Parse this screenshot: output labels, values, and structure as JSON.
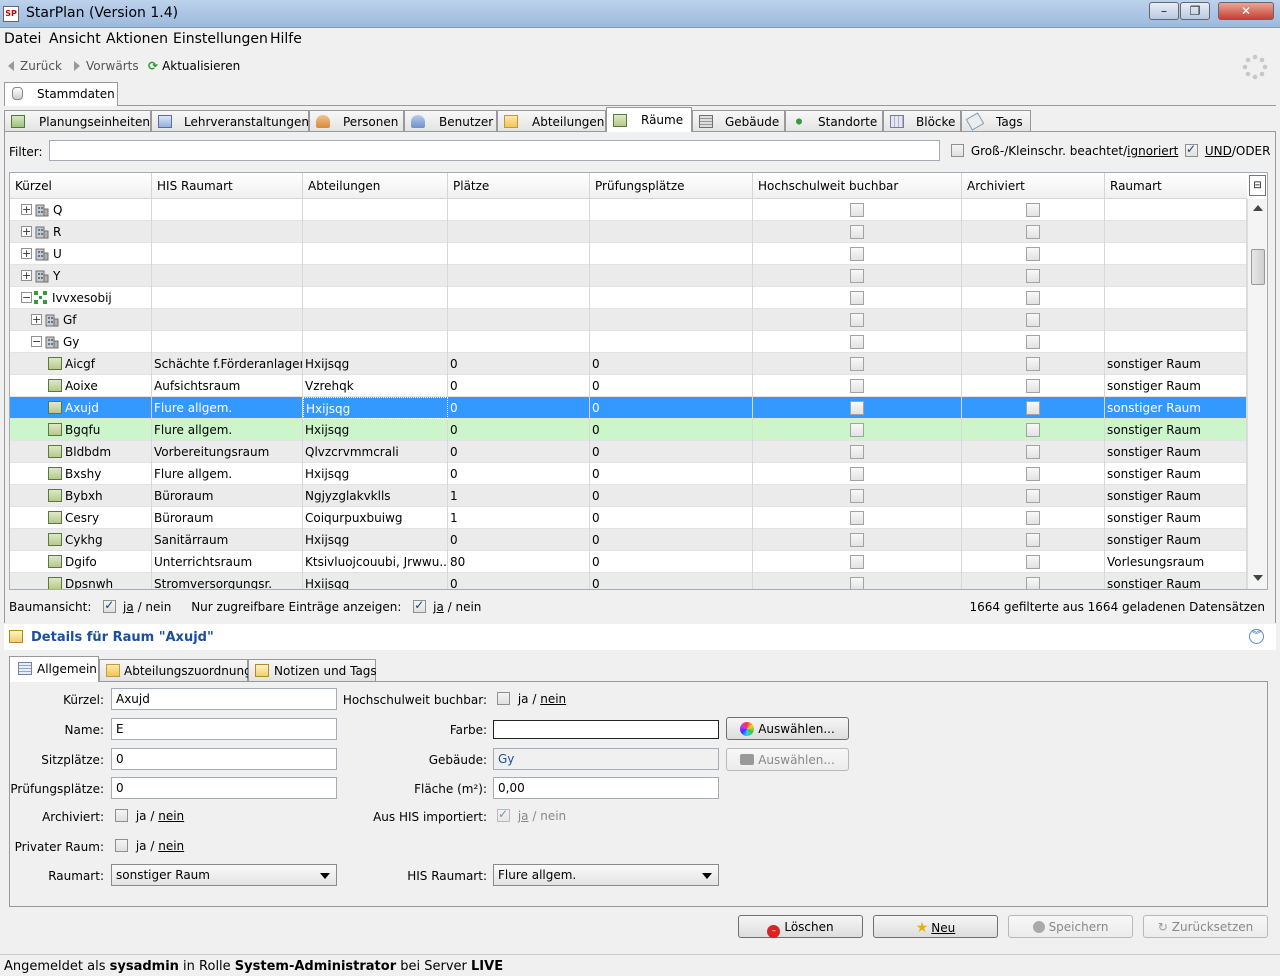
{
  "window": {
    "title": "StarPlan (Version 1.4)",
    "logo": "SP"
  },
  "menu": [
    "Datei",
    "Ansicht",
    "Aktionen",
    "Einstellungen",
    "Hilfe"
  ],
  "nav": {
    "back": "Zurück",
    "forward": "Vorwärts",
    "refresh": "Aktualisieren"
  },
  "top_tab": "Stammdaten",
  "tabs": [
    "Planungseinheiten",
    "Lehrveranstaltungen",
    "Personen",
    "Benutzer",
    "Abteilungen",
    "Räume",
    "Gebäude",
    "Standorte",
    "Blöcke",
    "Tags"
  ],
  "filter": {
    "label": "Filter:",
    "value": "",
    "case_pre": "Groß-/Kleinschr. beachtet/",
    "case_post": "ignoriert",
    "und": "UND",
    "oder": "/ODER"
  },
  "columns": [
    "Kürzel",
    "HIS Raumart",
    "Abteilungen",
    "Plätze",
    "Prüfungsplätze",
    "Hochschulweit buchbar",
    "Archiviert",
    "Raumart"
  ],
  "tree_rows": [
    {
      "name": "Q",
      "type": "building"
    },
    {
      "name": "R",
      "type": "building"
    },
    {
      "name": "U",
      "type": "building"
    },
    {
      "name": "Y",
      "type": "building"
    },
    {
      "name": "Ivvxesobij",
      "type": "site"
    },
    {
      "name": "Gf",
      "type": "building"
    },
    {
      "name": "Gy",
      "type": "building"
    }
  ],
  "rooms": [
    {
      "k": "Aicgf",
      "his": "Schächte f.Förderanlagen",
      "abt": "Hxijsqg",
      "pl": "0",
      "pp": "0",
      "art": "sonstiger Raum"
    },
    {
      "k": "Aoixe",
      "his": "Aufsichtsraum",
      "abt": "Vzrehqk",
      "pl": "0",
      "pp": "0",
      "art": "sonstiger Raum"
    },
    {
      "k": "Axujd",
      "his": "Flure allgem.",
      "abt": "Hxijsqg",
      "pl": "0",
      "pp": "0",
      "art": "sonstiger Raum"
    },
    {
      "k": "Bgqfu",
      "his": "Flure allgem.",
      "abt": "Hxijsqg",
      "pl": "0",
      "pp": "0",
      "art": "sonstiger Raum"
    },
    {
      "k": "Bldbdm",
      "his": "Vorbereitungsraum",
      "abt": "Qlvzcrvmmcrali",
      "pl": "0",
      "pp": "0",
      "art": "sonstiger Raum"
    },
    {
      "k": "Bxshy",
      "his": "Flure allgem.",
      "abt": "Hxijsqg",
      "pl": "0",
      "pp": "0",
      "art": "sonstiger Raum"
    },
    {
      "k": "Bybxh",
      "his": "Büroraum",
      "abt": "Ngjyzglakvklls",
      "pl": "1",
      "pp": "0",
      "art": "sonstiger Raum"
    },
    {
      "k": "Cesry",
      "his": "Büroraum",
      "abt": "Coiqurpuxbuiwg",
      "pl": "1",
      "pp": "0",
      "art": "sonstiger Raum"
    },
    {
      "k": "Cykhg",
      "his": "Sanitärraum",
      "abt": "Hxijsqg",
      "pl": "0",
      "pp": "0",
      "art": "sonstiger Raum"
    },
    {
      "k": "Dgifo",
      "his": "Unterrichtsraum",
      "abt": "Ktsivluojcouubi, Jrwwu...",
      "pl": "80",
      "pp": "0",
      "art": "Vorlesungsraum"
    },
    {
      "k": "Dpsnwh",
      "his": "Stromversorgungsr.",
      "abt": "Hxijsqg",
      "pl": "0",
      "pp": "0",
      "art": "sonstiger Raum"
    }
  ],
  "tree_opts": {
    "baum_label": "Baumansicht:",
    "nur_label": "Nur zugreifbare Einträge anzeigen:",
    "ja": "ja",
    "nein": "/ nein",
    "count": "1664 gefilterte aus 1664 geladenen Datensätzen"
  },
  "details": {
    "title": "Details für Raum \"Axujd\"",
    "tabs": [
      "Allgemein",
      "Abteilungszuordnung",
      "Notizen und Tags"
    ],
    "kuerzel_label": "Kürzel:",
    "kuerzel": "Axujd",
    "name_label": "Name:",
    "name": "E",
    "sitz_label": "Sitzplätze:",
    "sitz": "0",
    "pruef_label": "Prüfungsplätze:",
    "pruef": "0",
    "arch_label": "Archiviert:",
    "priv_label": "Privater Raum:",
    "raumart_label": "Raumart:",
    "raumart": "sonstiger Raum",
    "hsw_label": "Hochschulweit buchbar:",
    "farbe_label": "Farbe:",
    "geb_label": "Gebäude:",
    "geb": "Gy",
    "flaeche_label": "Fläche (m²):",
    "flaeche": "0,00",
    "his_imp_label": "Aus HIS importiert:",
    "his_label": "HIS Raumart:",
    "his": "Flure allgem.",
    "ja": "ja",
    "slash": "/",
    "nein": "nein",
    "choose": "Auswählen..."
  },
  "buttons": {
    "delete": "Löschen",
    "new": "Neu",
    "save": "Speichern",
    "reset": "Zurücksetzen"
  },
  "status": {
    "pre": "Angemeldet als ",
    "user": "sysadmin",
    "mid": " in Rolle ",
    "role": "System-Administrator",
    "mid2": " bei Server ",
    "server": "LIVE"
  },
  "colors": {
    "selection": "#3399ff",
    "highlight": "#ccf5cc",
    "link": "#1a4fa0"
  }
}
